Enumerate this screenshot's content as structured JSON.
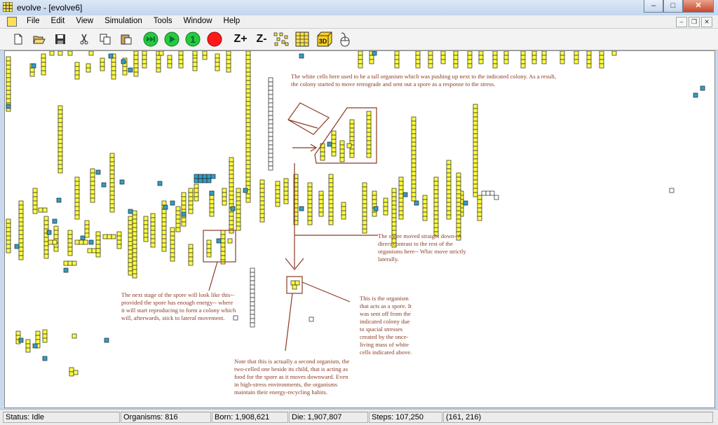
{
  "window": {
    "title": "evolve - [evolve6]"
  },
  "menu": {
    "items": [
      "File",
      "Edit",
      "View",
      "Simulation",
      "Tools",
      "Window",
      "Help"
    ]
  },
  "toolbar": {
    "icons": [
      "new-file-icon",
      "open-folder-icon",
      "save-disk-icon",
      "cut-scissors-icon",
      "copy-icon",
      "paste-icon",
      "fast-forward-icon",
      "play-icon",
      "step-one-icon",
      "stop-icon",
      "zoom-in-icon",
      "zoom-out-icon",
      "grid-scatter-icon",
      "grid-icon",
      "view-3d-icon",
      "mouse-icon"
    ],
    "step_label": "1",
    "zoom_in_label": "Z+",
    "zoom_out_label": "Z-",
    "view3d_label": "3D"
  },
  "colors": {
    "cell_yellow": "#ffff44",
    "cell_blue": "#2f9fc8",
    "cell_white": "#ffffff",
    "annotation": "#8a3b24"
  },
  "annotations": {
    "white_cells": "The white cells here used to be a tall organism which was pushing up next to the indicated colony. As a result,\nthe colony started to move retrograde and sent out a spore as a response to the stress.",
    "spore_moved": "The spore moved straight down- A\ndirect contrast to the rest of the\norganisms here-- Whic move strictly\nlaterally.",
    "next_stage": "The next stage of the spore will look like this--\nprovided the spore has enough energy-- where\nit will start reproducing to form a colony which\nwill, afterwards, stick to lateral movement.",
    "spore_org": "This is the organism\nthat acts as a spore. It\nwas sent off from the\nindicated colony due\nto spacial stresses\ncreated by the once-\nliving mass of white\ncells indicated above.",
    "second_org": "Note that this is actually a second organism, the\ntwo-celled one beside its child, that is acting as\nfood for the spore as it moves downward. Even\nin high-stress environments, the organisms\nmaintain their energy-recycling habits."
  },
  "status": {
    "state": "Status: Idle",
    "organisms": "Organisms: 816",
    "born": "Born: 1,908,621",
    "die": "Die: 1,907,807",
    "steps": "Steps: 107,250",
    "coords": "(161, 216)"
  }
}
